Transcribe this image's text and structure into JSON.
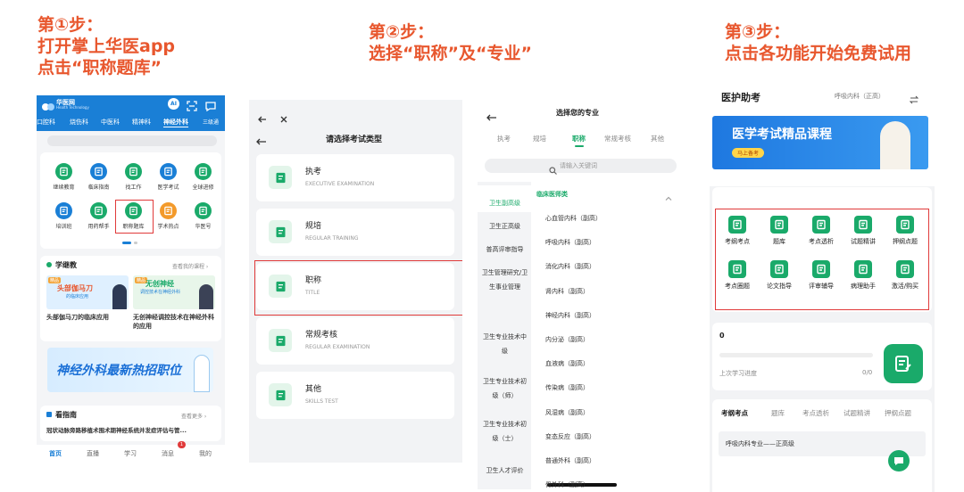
{
  "steps": [
    {
      "line1": "第①步：",
      "line2": "打开掌上华医app",
      "line3": "点击“职称题库”"
    },
    {
      "line1": "第②步：",
      "line2": "选择“职称”及“专业”"
    },
    {
      "line1": "第③步：",
      "line2": "点击各功能开始免费试用"
    }
  ],
  "p1": {
    "brand_cn": "华医网",
    "brand_en": "Health Technology",
    "tabs": [
      "口腔科",
      "烧伤科",
      "中医科",
      "精神科",
      "神经外科",
      "三级通"
    ],
    "active_tab": 4,
    "grid": [
      "继续教育",
      "临床指南",
      "找工作",
      "医学考试",
      "全球进修",
      "培训班",
      "用药帮手",
      "职称题库",
      "学术热点",
      "华医号"
    ],
    "section_title": "学继教",
    "section_more": "查看我的课程 ›",
    "card1_tag": "精品",
    "card1_banner": "头部伽马刀",
    "card1_banner2": "的临床应用",
    "card1_title": "头部伽马刀的临床应用",
    "card2_tag": "精品",
    "card2_banner": "无创神经",
    "card2_banner2": "调控技术在神经外科",
    "card2_title": "无创神经调控技术在神经外科的应用",
    "banner_text": "神经外科最新热招职位",
    "guide_title": "看指南",
    "guide_more": "查看更多 ›",
    "guide_item": "冠状动脉旁路移植术围术期神经系统并发症评估与管...",
    "bottom_nav": [
      "首页",
      "直播",
      "学习",
      "消息",
      "我的"
    ],
    "badge": "1"
  },
  "p2": {
    "title": "请选择考试类型",
    "items": [
      {
        "cn": "执考",
        "en": "EXECUTIVE EXAMINATION"
      },
      {
        "cn": "规培",
        "en": "REGULAR TRAINING"
      },
      {
        "cn": "职称",
        "en": "TITLE"
      },
      {
        "cn": "常规考核",
        "en": "REGULAR EXAMINATION"
      },
      {
        "cn": "其他",
        "en": "SKILLS TEST"
      }
    ]
  },
  "p3": {
    "title": "选择您的专业",
    "tabs": [
      "执考",
      "规培",
      "职称",
      "常规考核",
      "其他"
    ],
    "active_tab": 2,
    "search_placeholder": "请输入关键词",
    "left": [
      "卫生副高级",
      "卫生正高级",
      "普高评审指导",
      "卫生管理研究/卫生事业管理",
      "卫生专业技术中级",
      "卫生专业技术初级（师）",
      "卫生专业技术初级（士）",
      "卫生人才评价"
    ],
    "group": "临床医师类",
    "right": [
      "心血管内科（副高）",
      "呼吸内科（副高）",
      "消化内科（副高）",
      "肾内科（副高）",
      "神经内科（副高）",
      "内分泌（副高）",
      "血液病（副高）",
      "传染病（副高）",
      "风湿病（副高）",
      "变态反应（副高）",
      "普通外科（副高）",
      "骨外科（副高）"
    ]
  },
  "p4": {
    "title": "医护助考",
    "specialty": "呼吸内科（正高）",
    "banner": "医学考试精品课程",
    "banner_btn": "马上备考",
    "features": [
      "考纲考点",
      "题库",
      "考点透析",
      "试题精讲",
      "押纲点题",
      "考点圈题",
      "论文指导",
      "评审辅导",
      "病理助手",
      "激活/购买"
    ],
    "progress_value": "0",
    "progress_label": "上次学习进度",
    "progress_ratio": "0/0",
    "tabs": [
      "考纲考点",
      "题库",
      "考点透析",
      "试题精讲",
      "押纲点题"
    ],
    "item": "呼吸内科专业——正高级"
  },
  "colors": {
    "accent": "#e8572e",
    "green": "#1aaa6a",
    "blue": "#1a7fd6",
    "red": "#e03a3a"
  }
}
